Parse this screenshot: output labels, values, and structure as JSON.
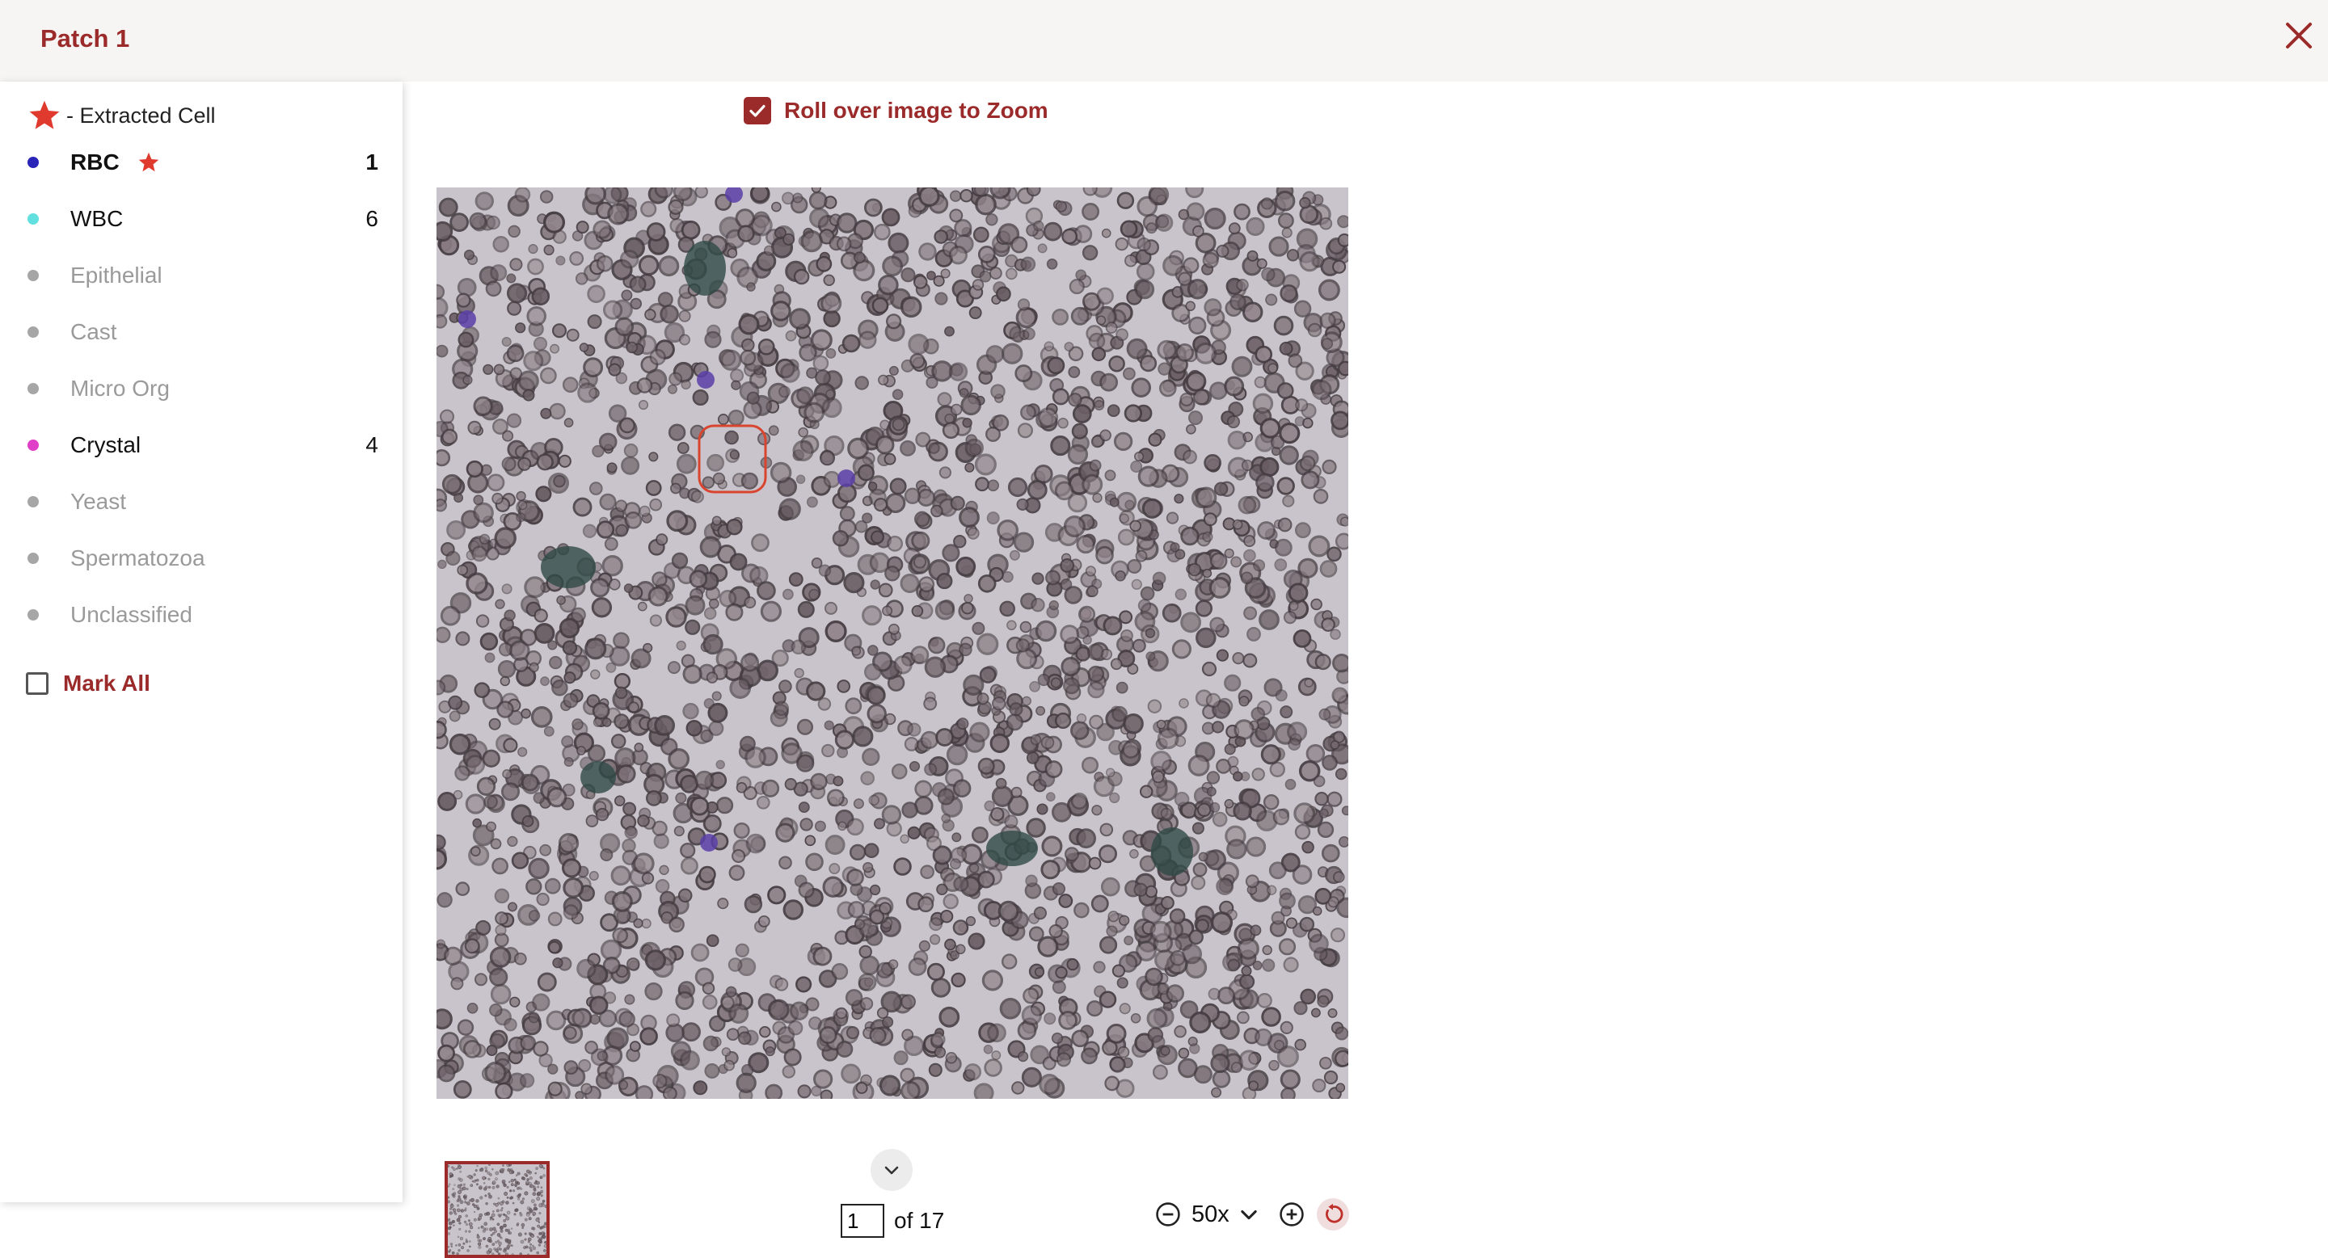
{
  "header": {
    "title": "Patch 1"
  },
  "legend": {
    "label": "- Extracted Cell"
  },
  "categories": [
    {
      "label": "RBC",
      "count": "1",
      "color": "#2b24b8",
      "active": true,
      "bold": true,
      "extracted": true
    },
    {
      "label": "WBC",
      "count": "6",
      "color": "#62e0e0",
      "active": true,
      "bold": false,
      "extracted": false
    },
    {
      "label": "Epithelial",
      "count": "",
      "color": "#a6a6a6",
      "active": false,
      "bold": false,
      "extracted": false
    },
    {
      "label": "Cast",
      "count": "",
      "color": "#a6a6a6",
      "active": false,
      "bold": false,
      "extracted": false
    },
    {
      "label": "Micro Org",
      "count": "",
      "color": "#a6a6a6",
      "active": false,
      "bold": false,
      "extracted": false
    },
    {
      "label": "Crystal",
      "count": "4",
      "color": "#e040c8",
      "active": true,
      "bold": false,
      "extracted": false
    },
    {
      "label": "Yeast",
      "count": "",
      "color": "#a6a6a6",
      "active": false,
      "bold": false,
      "extracted": false
    },
    {
      "label": "Spermatozoa",
      "count": "",
      "color": "#a6a6a6",
      "active": false,
      "bold": false,
      "extracted": false
    },
    {
      "label": "Unclassified",
      "count": "",
      "color": "#a6a6a6",
      "active": false,
      "bold": false,
      "extracted": false
    }
  ],
  "mark_all": {
    "label": "Mark All",
    "checked": false
  },
  "zoom_toggle": {
    "label": "Roll over image to Zoom",
    "checked": true
  },
  "pager": {
    "current": "1",
    "total_label": "of 17"
  },
  "zoom": {
    "level": "50x"
  },
  "colors": {
    "accent": "#9b2a2a",
    "star": "#e03a2f"
  },
  "icons": [
    "close-icon",
    "star-icon",
    "checkbox-icon",
    "chevron-down-icon",
    "zoom-out-icon",
    "zoom-in-icon",
    "reset-icon"
  ]
}
